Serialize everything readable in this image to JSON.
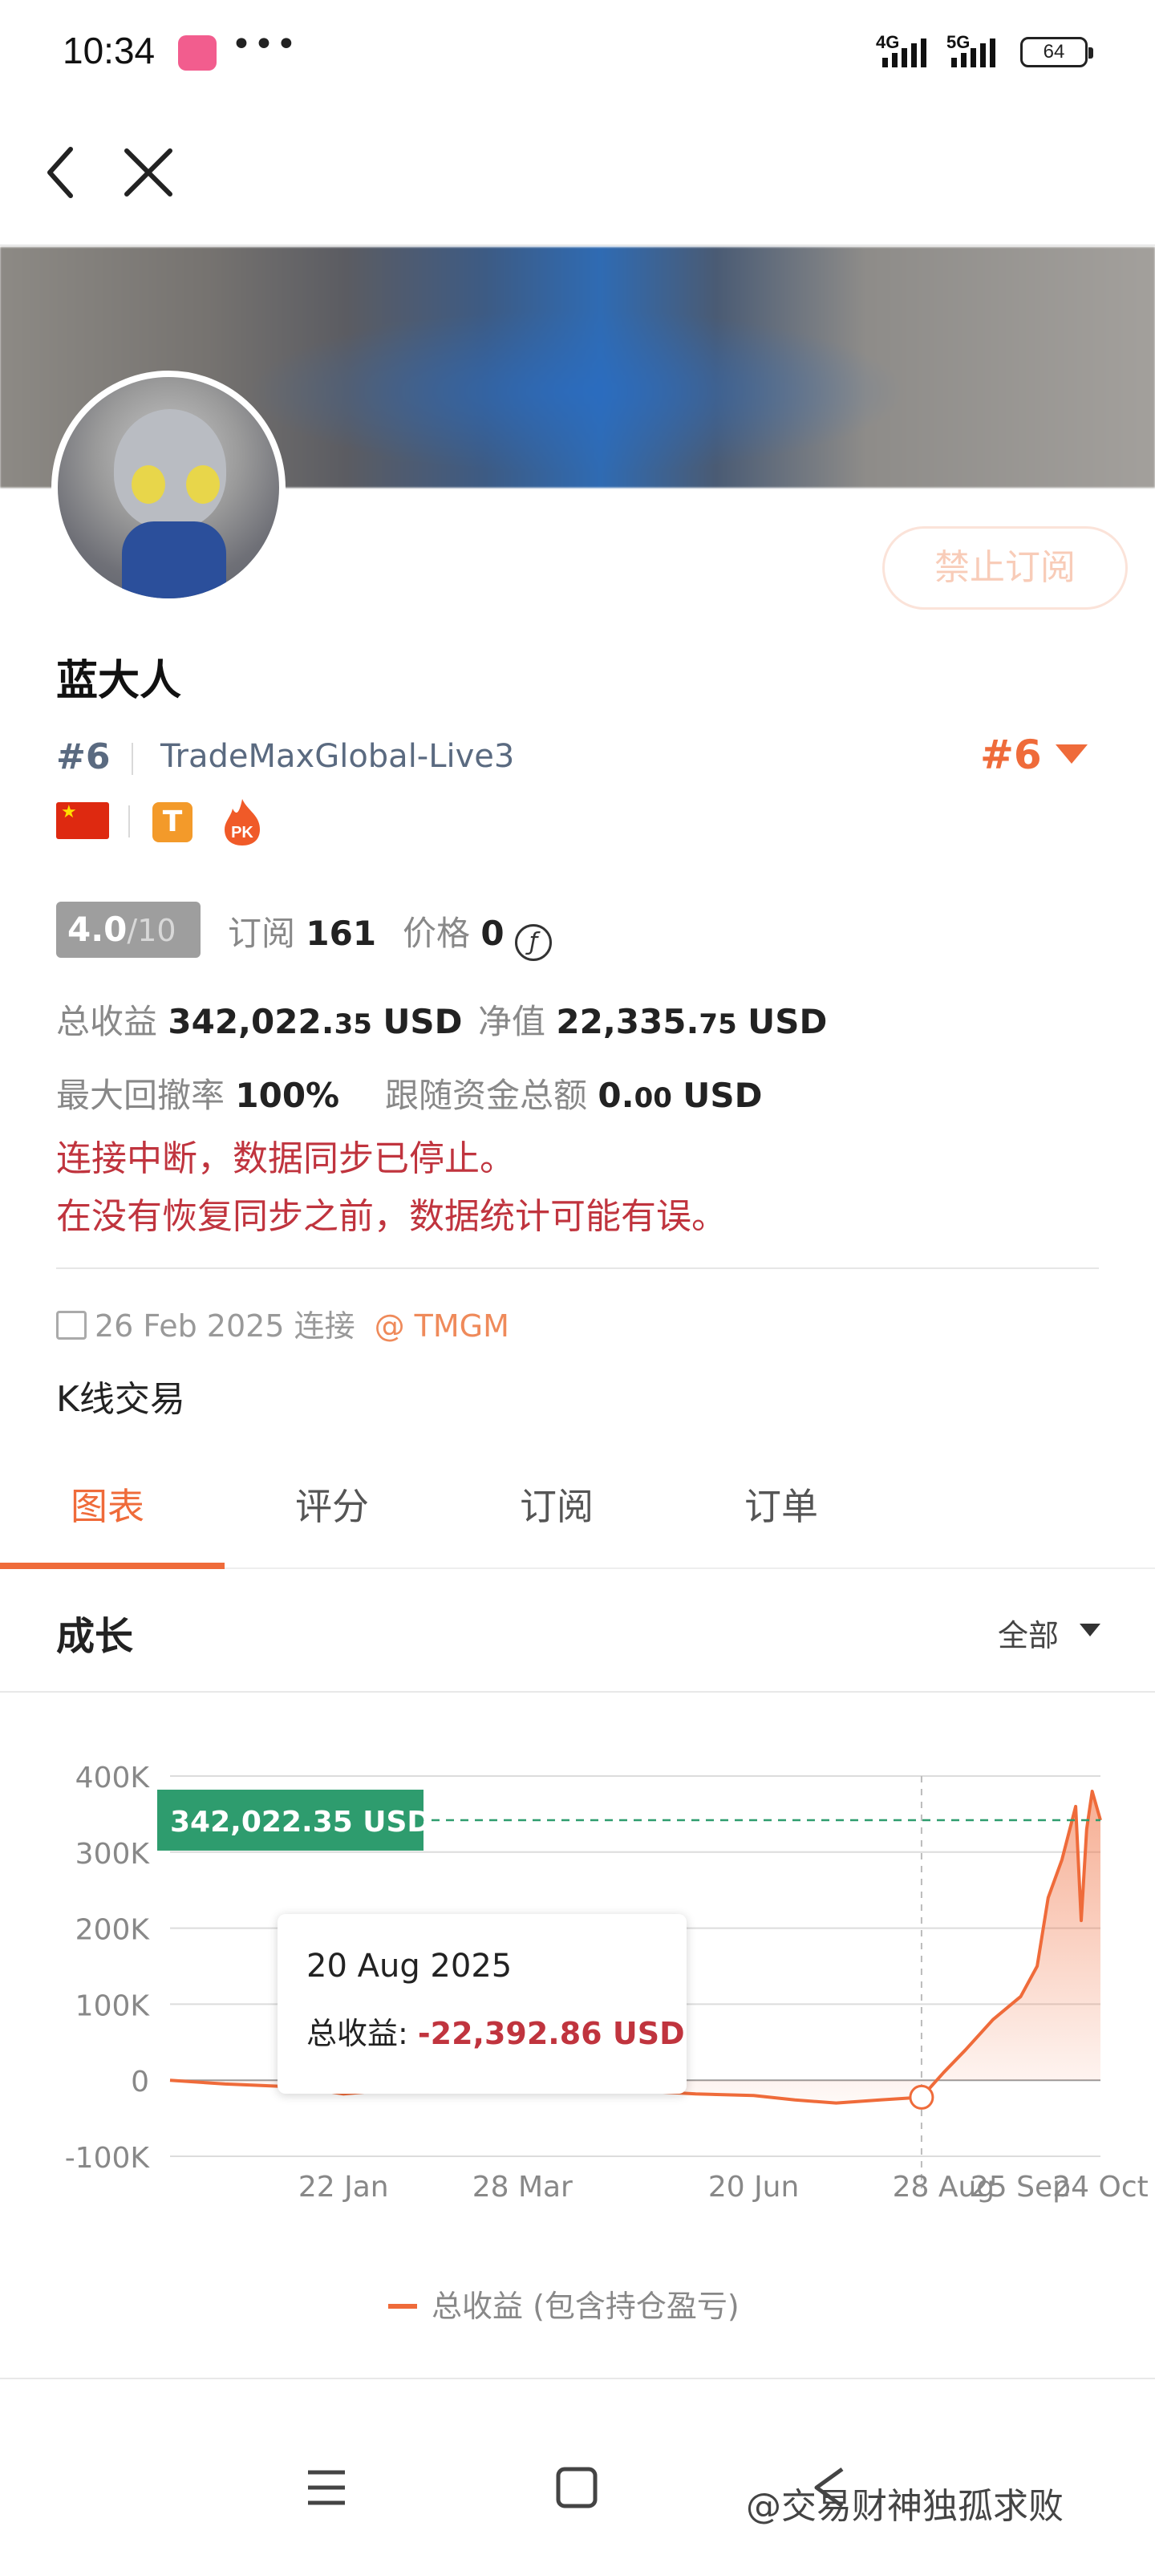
{
  "status_bar": {
    "time": "10:34",
    "dots": "•••",
    "net1": "4G",
    "net2": "5G",
    "battery": "64"
  },
  "profile": {
    "name": "蓝大人",
    "rank": "#6",
    "broker": "TradeMaxGlobal-Live3",
    "rank_right": "#6",
    "ban_button": "禁止订阅",
    "badge_t": "T",
    "badge_pk": "PK",
    "flag_star": "★"
  },
  "stats": {
    "score_value": "4.0",
    "score_max": "/10",
    "subscribe_label": "订阅",
    "subscribe_count": "161",
    "price_label": "价格",
    "price_value": "0",
    "price_icon": "ƒ",
    "total_profit_label": "总收益",
    "total_profit_main": "342,022.",
    "total_profit_dec": "35",
    "total_profit_unit": "USD",
    "equity_label": "净值",
    "equity_main": "22,335.",
    "equity_dec": "75",
    "equity_unit": "USD",
    "drawdown_label": "最大回撤率",
    "drawdown_value": "100%",
    "follow_label": "跟随资金总额",
    "follow_main": "0.",
    "follow_dec": "00",
    "follow_unit": "USD"
  },
  "warnings": {
    "line1": "连接中断，数据同步已停止。",
    "line2": "在没有恢复同步之前，数据统计可能有误。"
  },
  "connection": {
    "date_text": "26 Feb 2025 连接",
    "link": "@ TMGM",
    "strategy": "K线交易"
  },
  "tabs": [
    {
      "label": "图表"
    },
    {
      "label": "评分"
    },
    {
      "label": "订阅"
    },
    {
      "label": "订单"
    }
  ],
  "growth": {
    "title": "成长",
    "filter": "全部"
  },
  "tooltip": {
    "date": "20 Aug 2025",
    "label": "总收益: ",
    "value": "-22,392.86 USD"
  },
  "legend": {
    "label": "总收益 (包含持仓盈亏)"
  },
  "watermark": "@交易财神独孤求败",
  "colors": {
    "accent": "#ef6b3a",
    "danger": "#c0343e",
    "green_label": "#2e9c6e"
  },
  "chart_data": {
    "type": "area",
    "series": [
      {
        "name": "总收益 (包含持仓盈亏)",
        "points": [
          [
            "2024-11-20",
            0
          ],
          [
            "2024-12-10",
            -5000
          ],
          [
            "2024-12-30",
            -8000
          ],
          [
            "2025-01-15",
            -14000
          ],
          [
            "2025-01-22",
            -18000
          ],
          [
            "2025-02-10",
            -12000
          ],
          [
            "2025-02-26",
            -10000
          ],
          [
            "2025-03-10",
            -10000
          ],
          [
            "2025-03-28",
            -11000
          ],
          [
            "2025-04-20",
            -12000
          ],
          [
            "2025-05-10",
            -14000
          ],
          [
            "2025-05-30",
            -18000
          ],
          [
            "2025-06-20",
            -20000
          ],
          [
            "2025-07-05",
            -26000
          ],
          [
            "2025-07-20",
            -30000
          ],
          [
            "2025-08-05",
            -26000
          ],
          [
            "2025-08-20",
            -22392.86
          ],
          [
            "2025-08-28",
            10000
          ],
          [
            "2025-09-05",
            40000
          ],
          [
            "2025-09-15",
            80000
          ],
          [
            "2025-09-25",
            110000
          ],
          [
            "2025-10-01",
            150000
          ],
          [
            "2025-10-05",
            240000
          ],
          [
            "2025-10-10",
            290000
          ],
          [
            "2025-10-15",
            360000
          ],
          [
            "2025-10-17",
            210000
          ],
          [
            "2025-10-19",
            330000
          ],
          [
            "2025-10-21",
            380000
          ],
          [
            "2025-10-24",
            342022.35
          ]
        ]
      }
    ],
    "current_value_label": "342,022.35 USD",
    "current_value": 342022.35,
    "highlight_date": "2025-08-20",
    "x_ticks": [
      "22 Jan",
      "28 Mar",
      "20 Jun",
      "28 Aug",
      "25 Sep",
      "24 Oct"
    ],
    "x_tick_dates": [
      "2025-01-22",
      "2025-03-28",
      "2025-06-20",
      "2025-08-28",
      "2025-09-25",
      "2025-10-24"
    ],
    "y_ticks": [
      "400K",
      "300K",
      "200K",
      "100K",
      "0",
      "-100K"
    ],
    "y_tick_values": [
      400000,
      300000,
      200000,
      100000,
      0,
      -100000
    ],
    "ylim": [
      -100000,
      400000
    ],
    "xlim": [
      "2024-11-20",
      "2025-10-24"
    ],
    "grid": true,
    "legend_position": "bottom"
  }
}
